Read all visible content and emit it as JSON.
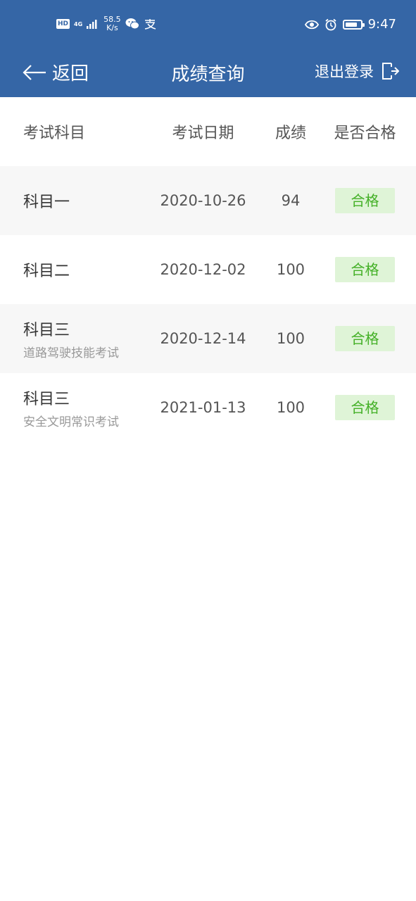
{
  "status_bar": {
    "hd": "HD",
    "network": "4G",
    "speed_value": "58.5",
    "speed_unit": "K/s",
    "time": "9:47",
    "icons": [
      "wechat-icon",
      "alipay-icon",
      "eye-icon",
      "alarm-icon",
      "battery-icon"
    ]
  },
  "nav": {
    "back_label": "返回",
    "title": "成绩查询",
    "logout_label": "退出登录"
  },
  "table": {
    "headers": {
      "subject": "考试科目",
      "date": "考试日期",
      "score": "成绩",
      "pass": "是否合格"
    },
    "rows": [
      {
        "subject": "科目一",
        "note": "",
        "date": "2020-10-26",
        "score": "94",
        "pass": "合格"
      },
      {
        "subject": "科目二",
        "note": "",
        "date": "2020-12-02",
        "score": "100",
        "pass": "合格"
      },
      {
        "subject": "科目三",
        "note": "道路驾驶技能考试",
        "date": "2020-12-14",
        "score": "100",
        "pass": "合格"
      },
      {
        "subject": "科目三",
        "note": "安全文明常识考试",
        "date": "2021-01-13",
        "score": "100",
        "pass": "合格"
      }
    ]
  },
  "colors": {
    "header_bg": "#3566a6",
    "pass_bg": "#dff4d7",
    "pass_text": "#44b027",
    "alt_row": "#f7f7f7"
  }
}
